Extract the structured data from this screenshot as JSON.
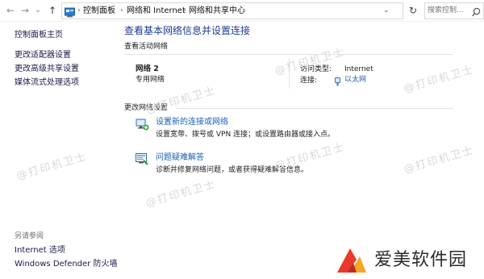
{
  "addressbar": {
    "back": "←",
    "forward": "→",
    "history": "⌄",
    "up": "↑",
    "breadcrumb": [
      "控制面板",
      "网络和 Internet",
      "网络和共享中心"
    ],
    "refresh": "↻",
    "search_placeholder": "搜索控制..."
  },
  "sidebar": {
    "home": "控制面板主页",
    "items": [
      "更改适配器设置",
      "更改高级共享设置",
      "媒体流式处理选项"
    ],
    "see_also_title": "另请参阅",
    "see_also": [
      "Internet 选项",
      "Windows Defender 防火墙"
    ]
  },
  "main": {
    "title": "查看基本网络信息并设置连接",
    "active_networks_heading": "查看活动网络",
    "network_name": "网络 2",
    "network_type": "专用网络",
    "access_type_label": "访问类型:",
    "access_type_value": "Internet",
    "connections_label": "连接:",
    "connections_value": "以太网",
    "change_settings_heading": "更改网络设置",
    "tasks": [
      {
        "link": "设置新的连接或网络",
        "desc": "设置宽带、拨号或 VPN 连接；或设置路由器或接入点。"
      },
      {
        "link": "问题疑难解答",
        "desc": "诊断并修复网络问题，或者获得疑难解答信息。"
      }
    ]
  },
  "watermark": "@打印机卫士",
  "logo": {
    "text": "爱美软件园"
  },
  "colors": {
    "link": "#1a5fb4",
    "title": "#1a3d8f",
    "logo_red": "#e8392b",
    "logo_orange": "#f5a623"
  }
}
